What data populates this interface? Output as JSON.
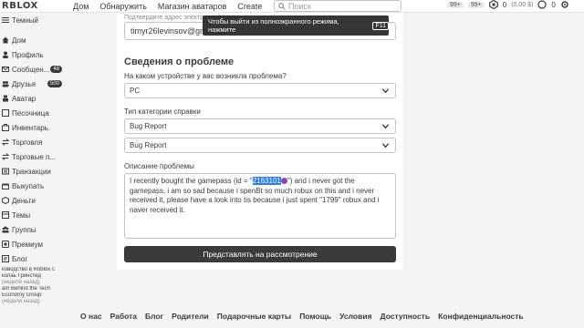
{
  "topbar": {
    "logo": "RBLOX",
    "nav": [
      "Дом",
      "Обнаружить",
      "Магазин аватаров",
      "Create"
    ],
    "search_placeholder": "Поиск",
    "badges": [
      "99+",
      "99+"
    ],
    "robux": "0",
    "robux_value": "(0,00 $)",
    "notifications": "0"
  },
  "sidebar": {
    "theme": "Темный",
    "items": [
      {
        "label": "Дом"
      },
      {
        "label": "Профиль"
      },
      {
        "label": "Сообщен...",
        "badge": "48"
      },
      {
        "label": "Друзья",
        "badge": "500"
      },
      {
        "label": "Аватар"
      },
      {
        "label": "Песочница"
      },
      {
        "label": "Инвентарь"
      },
      {
        "label": "Торговля"
      },
      {
        "label": "Торговые п..."
      },
      {
        "label": "Транзакции"
      },
      {
        "label": "Выкупать"
      },
      {
        "label": "Деньги"
      },
      {
        "label": "Темы"
      },
      {
        "label": "Группы"
      },
      {
        "label": "Премиум"
      },
      {
        "label": "Блог"
      }
    ],
    "footer_lines": [
      "ководство в Roblox с",
      "колаь Гринстед",
      "(неделя назад)",
      "am Behind the Tech",
      "Economy Group",
      "(неделя назад)"
    ]
  },
  "form": {
    "email_label": "Подтвердите адрес электронной почты",
    "email_value": "timyr26levinsov@gmail.com",
    "toast_text": "Чтобы выйти из полноэкранного режима, нажмите",
    "toast_key": "F11",
    "section_title": "Сведения о проблеме",
    "device_label": "На каком устройстве у вас возникла проблема?",
    "device_value": "PC",
    "category_label": "Тип категории справки",
    "category_value_1": "Bug Report",
    "category_value_2": "Bug Report",
    "description_label": "Описание проблемы",
    "description_before": "I recently bought the gamepass (id = \"",
    "description_highlight": "2163101",
    "description_after": "\") and i never got the gamepass, i am so sad because i spenBt so much robux on this and i never received it, please have a look into tis because i just spent \"1799\" robux and i naver received it.",
    "submit_label": "Представлять на рассмотрение"
  },
  "footer": [
    "О нас",
    "Работа",
    "Блог",
    "Родители",
    "Подарочные карты",
    "Помощь",
    "Условия",
    "Доступность",
    "Конфиденциальность"
  ]
}
